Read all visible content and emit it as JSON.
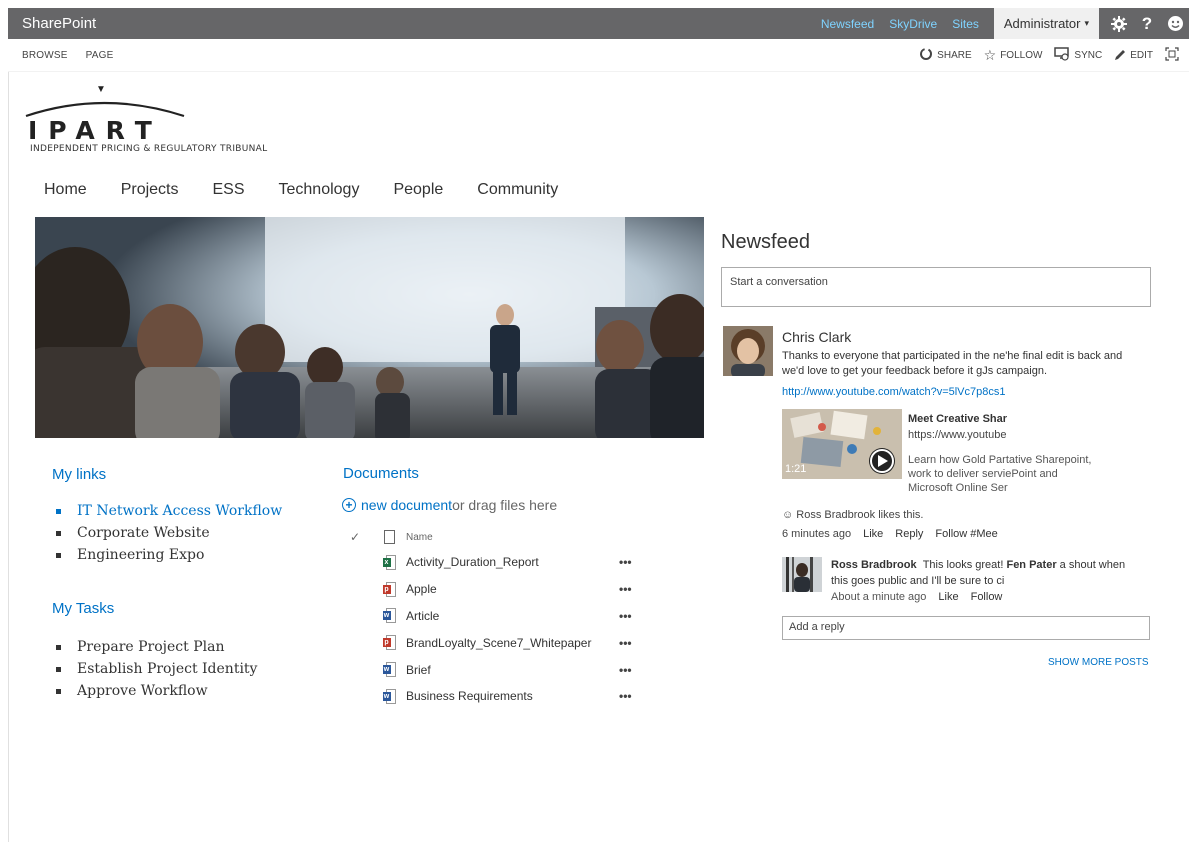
{
  "suitebar": {
    "brand": "SharePoint",
    "links": [
      "Newsfeed",
      "SkyDrive",
      "Sites"
    ],
    "user": "Administrator",
    "user_caret": "▾",
    "icons": [
      "gear-icon",
      "help-icon",
      "smiley-icon"
    ],
    "help_glyph": "?"
  },
  "ribbon": {
    "tabs": [
      "BROWSE",
      "PAGE"
    ],
    "actions": [
      {
        "label": "SHARE",
        "icon": "share-icon"
      },
      {
        "label": "FOLLOW",
        "icon": "star-icon"
      },
      {
        "label": "SYNC",
        "icon": "sync-icon"
      },
      {
        "label": "EDIT",
        "icon": "pencil-icon"
      }
    ]
  },
  "logo": {
    "word": "IPART",
    "subtitle": "INDEPENDENT PRICING & REGULATORY TRIBUNAL"
  },
  "nav": [
    "Home",
    "Projects",
    "ESS",
    "Technology",
    "People",
    "Community"
  ],
  "my_links": {
    "title": "My links",
    "items": [
      "IT Network Access Workflow",
      "Corporate Website",
      "Engineering Expo"
    ]
  },
  "my_tasks": {
    "title": "My Tasks",
    "items": [
      "Prepare Project Plan",
      "Establish Project Identity",
      "Approve Workflow"
    ]
  },
  "documents": {
    "title": "Documents",
    "new_label": "new document",
    "drag_label": " or drag files here",
    "column_name": "Name",
    "check_glyph": "✓",
    "files": [
      {
        "name": "Activity_Duration_Report",
        "type": "excel",
        "tag": "x",
        "color": "#1e7145"
      },
      {
        "name": "Apple",
        "type": "pdf",
        "tag": "p",
        "color": "#c0392b"
      },
      {
        "name": "Article",
        "type": "word",
        "tag": "w",
        "color": "#2b579a"
      },
      {
        "name": "BrandLoyalty_Scene7_Whitepaper",
        "type": "pdf",
        "tag": "p",
        "color": "#c0392b"
      },
      {
        "name": "Brief",
        "type": "word",
        "tag": "w",
        "color": "#2b579a"
      },
      {
        "name": "Business Requirements",
        "type": "word",
        "tag": "w",
        "color": "#2b579a"
      }
    ],
    "more_glyph": "•••"
  },
  "newsfeed": {
    "title": "Newsfeed",
    "input_placeholder": "Start a conversation",
    "post": {
      "author": "Chris Clark",
      "text": "Thanks to everyone that participated in the ne'he final edit is back and we'd love to get your feedback before it gJs campaign.",
      "link": "http://www.youtube.com/watch?v=5lVc7p8cs1",
      "media": {
        "title": "Meet Creative Shar",
        "url": "https://www.youtube",
        "description": "Learn how Gold Partative Sharepoint, work to deliver serviePoint and Microsoft Online Ser",
        "duration": "1:21"
      },
      "likes": "Ross Bradbrook likes this.",
      "time": "6 minutes ago",
      "actions": [
        "Like",
        "Reply",
        "Follow #Mee"
      ]
    },
    "reply": {
      "author": "Ross Bradbrook",
      "text_a": "This looks great! ",
      "mention": "Fen Pater",
      "text_b": " a shout when this goes public and I'll be sure to ci",
      "time": "About a minute ago",
      "actions": [
        "Like",
        "Follow"
      ]
    },
    "reply_placeholder": "Add a reply",
    "show_more": "SHOW MORE POSTS"
  }
}
